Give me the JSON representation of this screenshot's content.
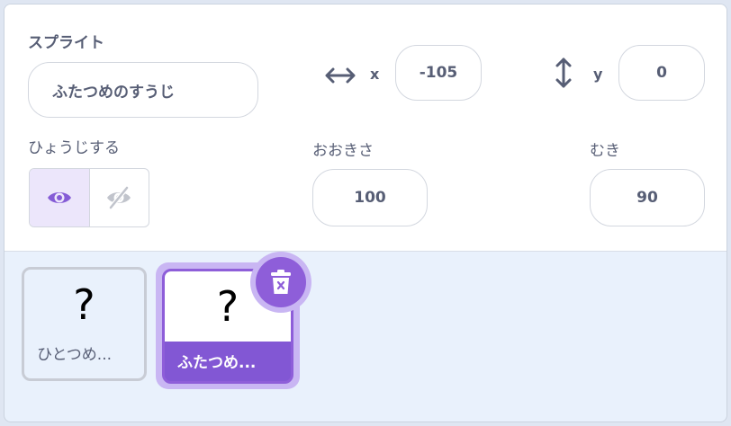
{
  "sprite_info": {
    "sprite_label": "スプライト",
    "sprite_name": "ふたつめのすうじ",
    "x_label": "x",
    "x_value": "-105",
    "y_label": "y",
    "y_value": "0",
    "show_label": "ひょうじする",
    "size_label": "おおきさ",
    "size_value": "100",
    "direction_label": "むき",
    "direction_value": "90"
  },
  "sprites": [
    {
      "thumb": "?",
      "name": "ひとつめ...",
      "selected": false
    },
    {
      "thumb": "?",
      "name": "ふたつめ...",
      "selected": true
    }
  ],
  "colors": {
    "accent": "#855cd6",
    "text": "#575e75",
    "sprite_area_bg": "#e9f1fc"
  }
}
